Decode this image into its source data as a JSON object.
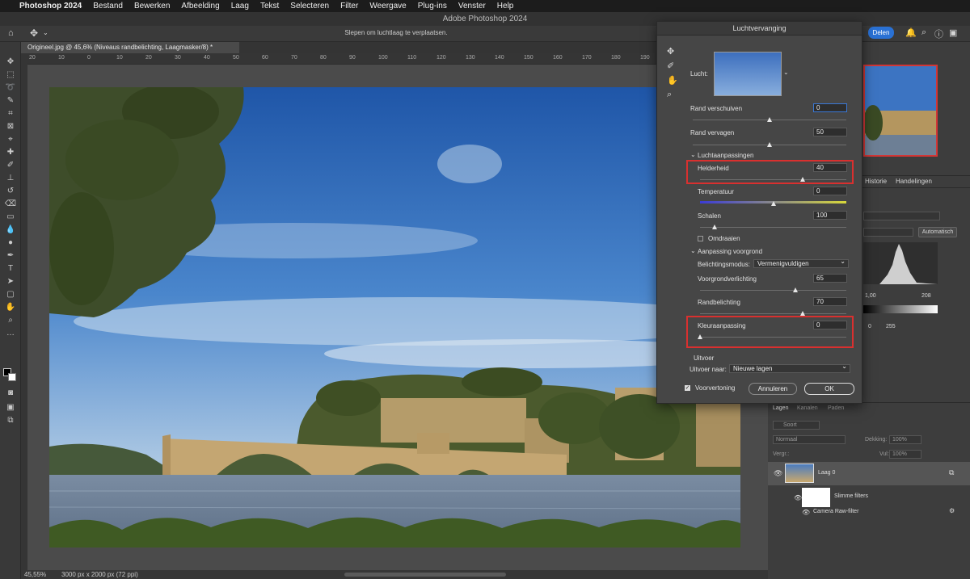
{
  "menubar": {
    "app_name": "Photoshop 2024",
    "items": [
      "Bestand",
      "Bewerken",
      "Afbeelding",
      "Laag",
      "Tekst",
      "Selecteren",
      "Filter",
      "Weergave",
      "Plug-ins",
      "Venster",
      "Help"
    ]
  },
  "window_title": "Adobe Photoshop 2024",
  "options_bar": {
    "hint": "Slepen om luchtlaag te verplaatsen.",
    "share_label": "Delen"
  },
  "document": {
    "tab_title": "Origineel.jpg @ 45,6% (Niveaus randbelichting, Laagmasker/8) *",
    "ruler_ticks": [
      "20",
      "10",
      "0",
      "10",
      "20",
      "30",
      "40",
      "50",
      "60",
      "70",
      "80",
      "90",
      "100",
      "110",
      "120",
      "130",
      "140",
      "150",
      "160",
      "170",
      "180",
      "190"
    ],
    "zoom": "45,55%",
    "dimensions": "3000 px x 2000 px (72 ppi)"
  },
  "dialog": {
    "title": "Luchtvervanging",
    "sky_label": "Lucht:",
    "shift_edge": {
      "label": "Rand verschuiven",
      "value": "0",
      "level": 0.5
    },
    "fade_edge": {
      "label": "Rand vervagen",
      "value": "50",
      "level": 0.5
    },
    "sky_adjustments_heading": "Luchtaanpassingen",
    "brightness": {
      "label": "Helderheid",
      "value": "40",
      "level": 0.7
    },
    "temperature": {
      "label": "Temperatuur",
      "value": "0",
      "level": 0.5
    },
    "scale": {
      "label": "Schalen",
      "value": "100",
      "level": 0.1
    },
    "flip_label": "Omdraaien",
    "foreground_heading": "Aanpassing voorgrond",
    "lighting_mode": {
      "label": "Belichtingsmodus:",
      "value": "Vermenigvuldigen"
    },
    "foreground_lighting": {
      "label": "Voorgrondverlichting",
      "value": "65",
      "level": 0.65
    },
    "edge_lighting": {
      "label": "Randbelichting",
      "value": "70",
      "level": 0.7
    },
    "color_adjust": {
      "label": "Kleuraanpassing",
      "value": "0",
      "level": 0
    },
    "output_heading": "Uitvoer",
    "output_to": {
      "label": "Uitvoer naar:",
      "value": "Nieuwe lagen"
    },
    "preview_label": "Voorvertoning",
    "cancel_label": "Annuleren",
    "ok_label": "OK"
  },
  "right_panel": {
    "tabs_mid": [
      "Historie",
      "Handelingen"
    ],
    "auto_button": "Automatisch",
    "histogram_labels": [
      "1,00",
      "208"
    ],
    "output_values": [
      "0",
      "255"
    ],
    "layer_tabs": [
      "Lagen",
      "Kanalen",
      "Paden"
    ],
    "search_placeholder": "Soort",
    "blend_mode": "Normaal",
    "opacity_label": "Dekking:",
    "opacity_value": "100%",
    "lock_label": "Vergr.:",
    "fill_label": "Vul:",
    "fill_value": "100%",
    "layers": [
      {
        "name": "Laag 0"
      },
      {
        "name": "Slimme filters"
      },
      {
        "name": "Camera Raw-filter"
      }
    ]
  },
  "colors": {
    "accent": "#2a71d4",
    "highlight": "#d9302f",
    "panel": "#3d3d3d"
  }
}
